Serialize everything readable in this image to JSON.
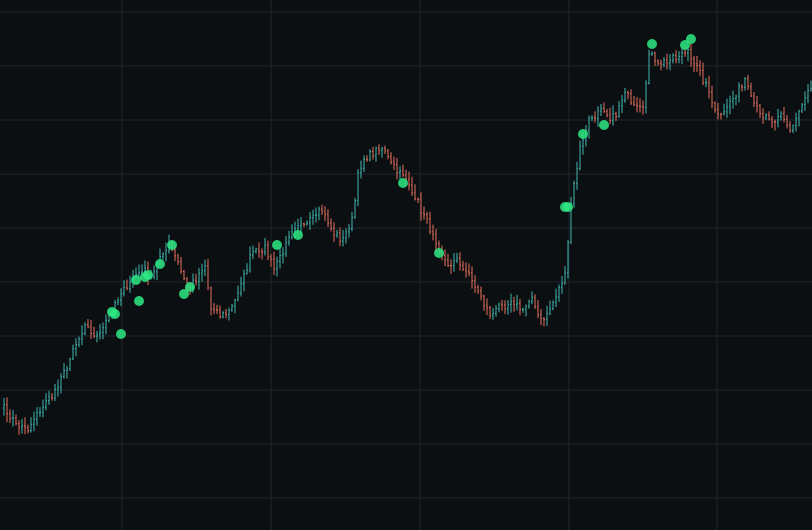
{
  "colors": {
    "background": "#0c0f12",
    "grid": "#1e2429",
    "up_bar": "#3fb7ad",
    "down_bar": "#e36f5b",
    "marker": "#2ee882"
  },
  "chart_data": {
    "type": "ohlc",
    "title": "",
    "xlabel": "",
    "ylabel": "",
    "grid": true,
    "xlim": [
      0,
      271
    ],
    "ylim": [
      0,
      100
    ],
    "anchors": [
      [
        0,
        19.2
      ],
      [
        5,
        15.2
      ],
      [
        9,
        13.8
      ],
      [
        13,
        18.0
      ],
      [
        19,
        22.6
      ],
      [
        24,
        29.6
      ],
      [
        28,
        34.4
      ],
      [
        32,
        32.6
      ],
      [
        36,
        37.4
      ],
      [
        38,
        38.8
      ],
      [
        43,
        44.0
      ],
      [
        47,
        46.2
      ],
      [
        50,
        44.8
      ],
      [
        53,
        48.0
      ],
      [
        56,
        51.6
      ],
      [
        59,
        47.8
      ],
      [
        62,
        42.4
      ],
      [
        65,
        43.8
      ],
      [
        68,
        46.6
      ],
      [
        70,
        38.2
      ],
      [
        73,
        36.8
      ],
      [
        76,
        37.8
      ],
      [
        80,
        42.8
      ],
      [
        84,
        50.4
      ],
      [
        88,
        50.2
      ],
      [
        91,
        46.8
      ],
      [
        94,
        49.8
      ],
      [
        97,
        53.0
      ],
      [
        100,
        54.8
      ],
      [
        104,
        57.6
      ],
      [
        107,
        58.2
      ],
      [
        110,
        54.0
      ],
      [
        113,
        52.2
      ],
      [
        115,
        53.0
      ],
      [
        117,
        56.6
      ],
      [
        119,
        64.8
      ],
      [
        122,
        68.8
      ],
      [
        125,
        69.6
      ],
      [
        128,
        70.2
      ],
      [
        131,
        67.0
      ],
      [
        134,
        64.6
      ],
      [
        137,
        62.2
      ],
      [
        140,
        58.0
      ],
      [
        143,
        54.4
      ],
      [
        146,
        48.8
      ],
      [
        149,
        47.0
      ],
      [
        152,
        47.8
      ],
      [
        155,
        45.8
      ],
      [
        158,
        42.8
      ],
      [
        161,
        39.2
      ],
      [
        163,
        37.0
      ],
      [
        165,
        38.6
      ],
      [
        168,
        38.0
      ],
      [
        171,
        39.6
      ],
      [
        174,
        38.2
      ],
      [
        177,
        39.8
      ],
      [
        180,
        36.4
      ],
      [
        182,
        37.0
      ],
      [
        185,
        40.6
      ],
      [
        188,
        45.0
      ],
      [
        190,
        59.6
      ],
      [
        193,
        70.4
      ],
      [
        196,
        76.2
      ],
      [
        200,
        77.8
      ],
      [
        203,
        75.6
      ],
      [
        206,
        78.4
      ],
      [
        208,
        81.2
      ],
      [
        211,
        79.6
      ],
      [
        214,
        79.2
      ],
      [
        216,
        89.0
      ],
      [
        220,
        87.6
      ],
      [
        223,
        88.0
      ],
      [
        226,
        88.4
      ],
      [
        229,
        90.2
      ],
      [
        232,
        86.4
      ],
      [
        236,
        81.6
      ],
      [
        239,
        77.0
      ],
      [
        242,
        79.0
      ],
      [
        245,
        80.8
      ],
      [
        248,
        84.4
      ],
      [
        251,
        80.2
      ],
      [
        254,
        76.8
      ],
      [
        257,
        75.2
      ],
      [
        260,
        76.6
      ],
      [
        263,
        73.8
      ],
      [
        266,
        77.8
      ],
      [
        269,
        81.6
      ],
      [
        271,
        82.4
      ]
    ],
    "markers": [
      {
        "x": 37,
        "y": 37.6
      },
      {
        "x": 38,
        "y": 37.2
      },
      {
        "x": 40,
        "y": 33.2
      },
      {
        "x": 45,
        "y": 44.0
      },
      {
        "x": 46,
        "y": 39.8
      },
      {
        "x": 48,
        "y": 44.6
      },
      {
        "x": 49,
        "y": 45.0
      },
      {
        "x": 53,
        "y": 47.2
      },
      {
        "x": 57,
        "y": 51.0
      },
      {
        "x": 61,
        "y": 41.2
      },
      {
        "x": 63,
        "y": 42.6
      },
      {
        "x": 92,
        "y": 51.0
      },
      {
        "x": 99,
        "y": 53.0
      },
      {
        "x": 134,
        "y": 63.4
      },
      {
        "x": 146,
        "y": 49.4
      },
      {
        "x": 188,
        "y": 58.6
      },
      {
        "x": 189,
        "y": 58.6
      },
      {
        "x": 194,
        "y": 73.2
      },
      {
        "x": 201,
        "y": 75.0
      },
      {
        "x": 217,
        "y": 91.2
      },
      {
        "x": 228,
        "y": 91.0
      },
      {
        "x": 230,
        "y": 92.2
      }
    ]
  }
}
